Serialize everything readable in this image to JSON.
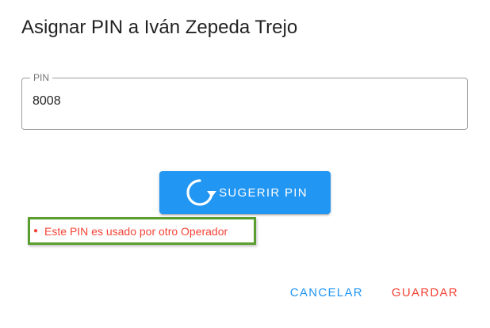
{
  "dialog": {
    "title": "Asignar PIN a Iván Zepeda Trejo"
  },
  "pin_field": {
    "label": "PIN",
    "value": "8008"
  },
  "suggest_button": {
    "label": "SUGERIR PIN",
    "icon": "refresh-icon",
    "color": "#2196f3"
  },
  "error": {
    "message": "Este PIN es usado por otro Operador",
    "color": "#f44336",
    "highlight_color": "#5a9e2f"
  },
  "actions": {
    "cancel_label": "CANCELAR",
    "cancel_color": "#2196f3",
    "save_label": "GUARDAR",
    "save_color": "#f44336"
  }
}
